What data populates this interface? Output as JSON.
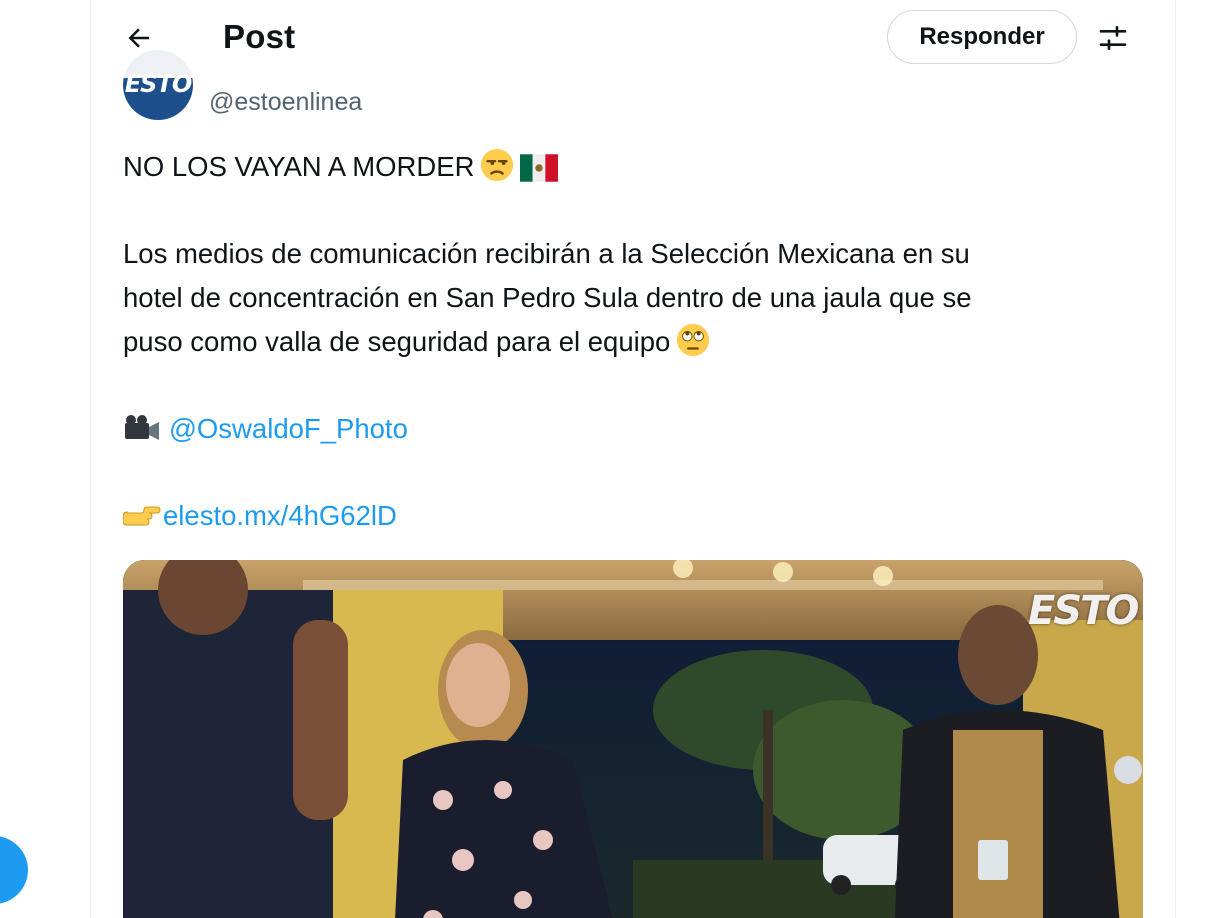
{
  "header": {
    "title": "Post",
    "reply_label": "Responder"
  },
  "author": {
    "handle": "@estoenlinea",
    "avatar_text": "ESTO"
  },
  "tweet": {
    "line1": "NO LOS VAYAN A MORDER",
    "line2": "Los medios de comunicación recibirán a la Selección Mexicana en su",
    "line3": "hotel de concentración en San Pedro Sula dentro de una jaula que se",
    "line4": "puso como valla de seguridad para el equipo",
    "mention": "@OswaldoF_Photo",
    "url": "elesto.mx/4hG62lD"
  },
  "media": {
    "watermark": "ESTO"
  },
  "icons": {
    "back": "arrow-left-icon",
    "settings": "sliders-icon",
    "emoji1": "unamused-face-icon",
    "emoji2": "mexico-flag-icon",
    "emoji3": "rolling-eyes-face-icon",
    "emoji4": "video-camera-icon",
    "emoji5": "pointing-right-icon"
  },
  "colors": {
    "link": "#1d9bf0",
    "text": "#0f1419",
    "secondary": "#536471",
    "border": "#cfd9de"
  }
}
